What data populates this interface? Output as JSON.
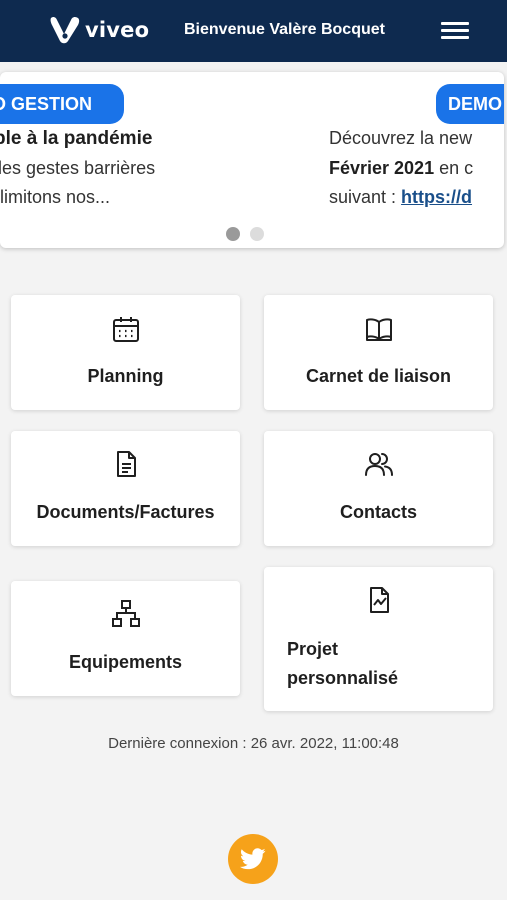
{
  "header": {
    "logo_text": "viveo",
    "welcome": "Bienvenue Valère Bocquet",
    "bg_color": "#0e2a4f"
  },
  "carousel": {
    "slide1": {
      "tag": "O GESTION",
      "title": "semble à la pandémie",
      "line1": "uls les gestes barrières",
      "line2": "ors limitons nos..."
    },
    "slide2": {
      "tag": "DEMO",
      "line1": "Découvrez la new",
      "line2_bold": "Février 2021",
      "line2_rest": " en c",
      "line3": "suivant : ",
      "link": "https://d"
    },
    "active_index": 0,
    "tag_color": "#1a73e8"
  },
  "tiles": {
    "planning": {
      "label": "Planning",
      "icon": "calendar-icon"
    },
    "carnet": {
      "label": "Carnet de liaison",
      "icon": "book-icon"
    },
    "documents": {
      "label": "Documents/Factures",
      "icon": "document-icon"
    },
    "contacts": {
      "label": "Contacts",
      "icon": "users-icon"
    },
    "equipements": {
      "label": "Equipements",
      "icon": "sitemap-icon"
    },
    "projet": {
      "label_line1": "Projet",
      "label_line2": "personnalisé",
      "icon": "file-chart-icon"
    }
  },
  "footer": {
    "last_connection": "Dernière connexion : 26 avr. 2022, 11:00:48",
    "twitter_icon": "twitter-icon",
    "twitter_color": "#f6a21a"
  }
}
